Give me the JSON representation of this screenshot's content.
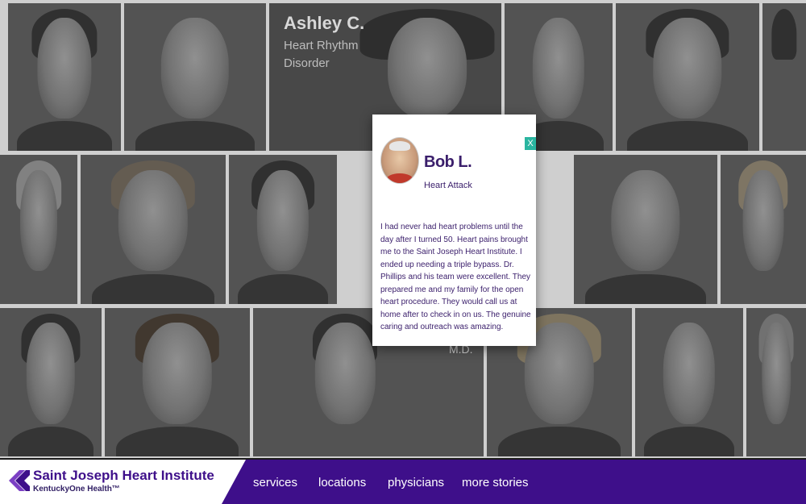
{
  "featured_story": {
    "name": "Ashley C.",
    "condition_line1": "Heart Rhythm",
    "condition_line2": "Disorder"
  },
  "background_label": "M.D.",
  "popup": {
    "close_label": "X",
    "name": "Bob L.",
    "condition": "Heart Attack",
    "quote": "I had never had heart problems until the day after I turned 50. Heart pains brought me to the Saint Joseph Heart Institute. I ended up needing a triple bypass. Dr. Phillips and his team were excellent. They prepared me and my family for the open heart procedure. They would call us at home after to check in on us. The genuine caring and outreach was amazing."
  },
  "footer": {
    "brand": "Saint Joseph Heart Institute",
    "sub_brand": "KentuckyOne Health™",
    "nav": [
      "services",
      "locations",
      "physicians",
      "more stories"
    ]
  },
  "colors": {
    "brand_purple": "#3e0f8a",
    "accent_teal": "#2ab5a0"
  }
}
